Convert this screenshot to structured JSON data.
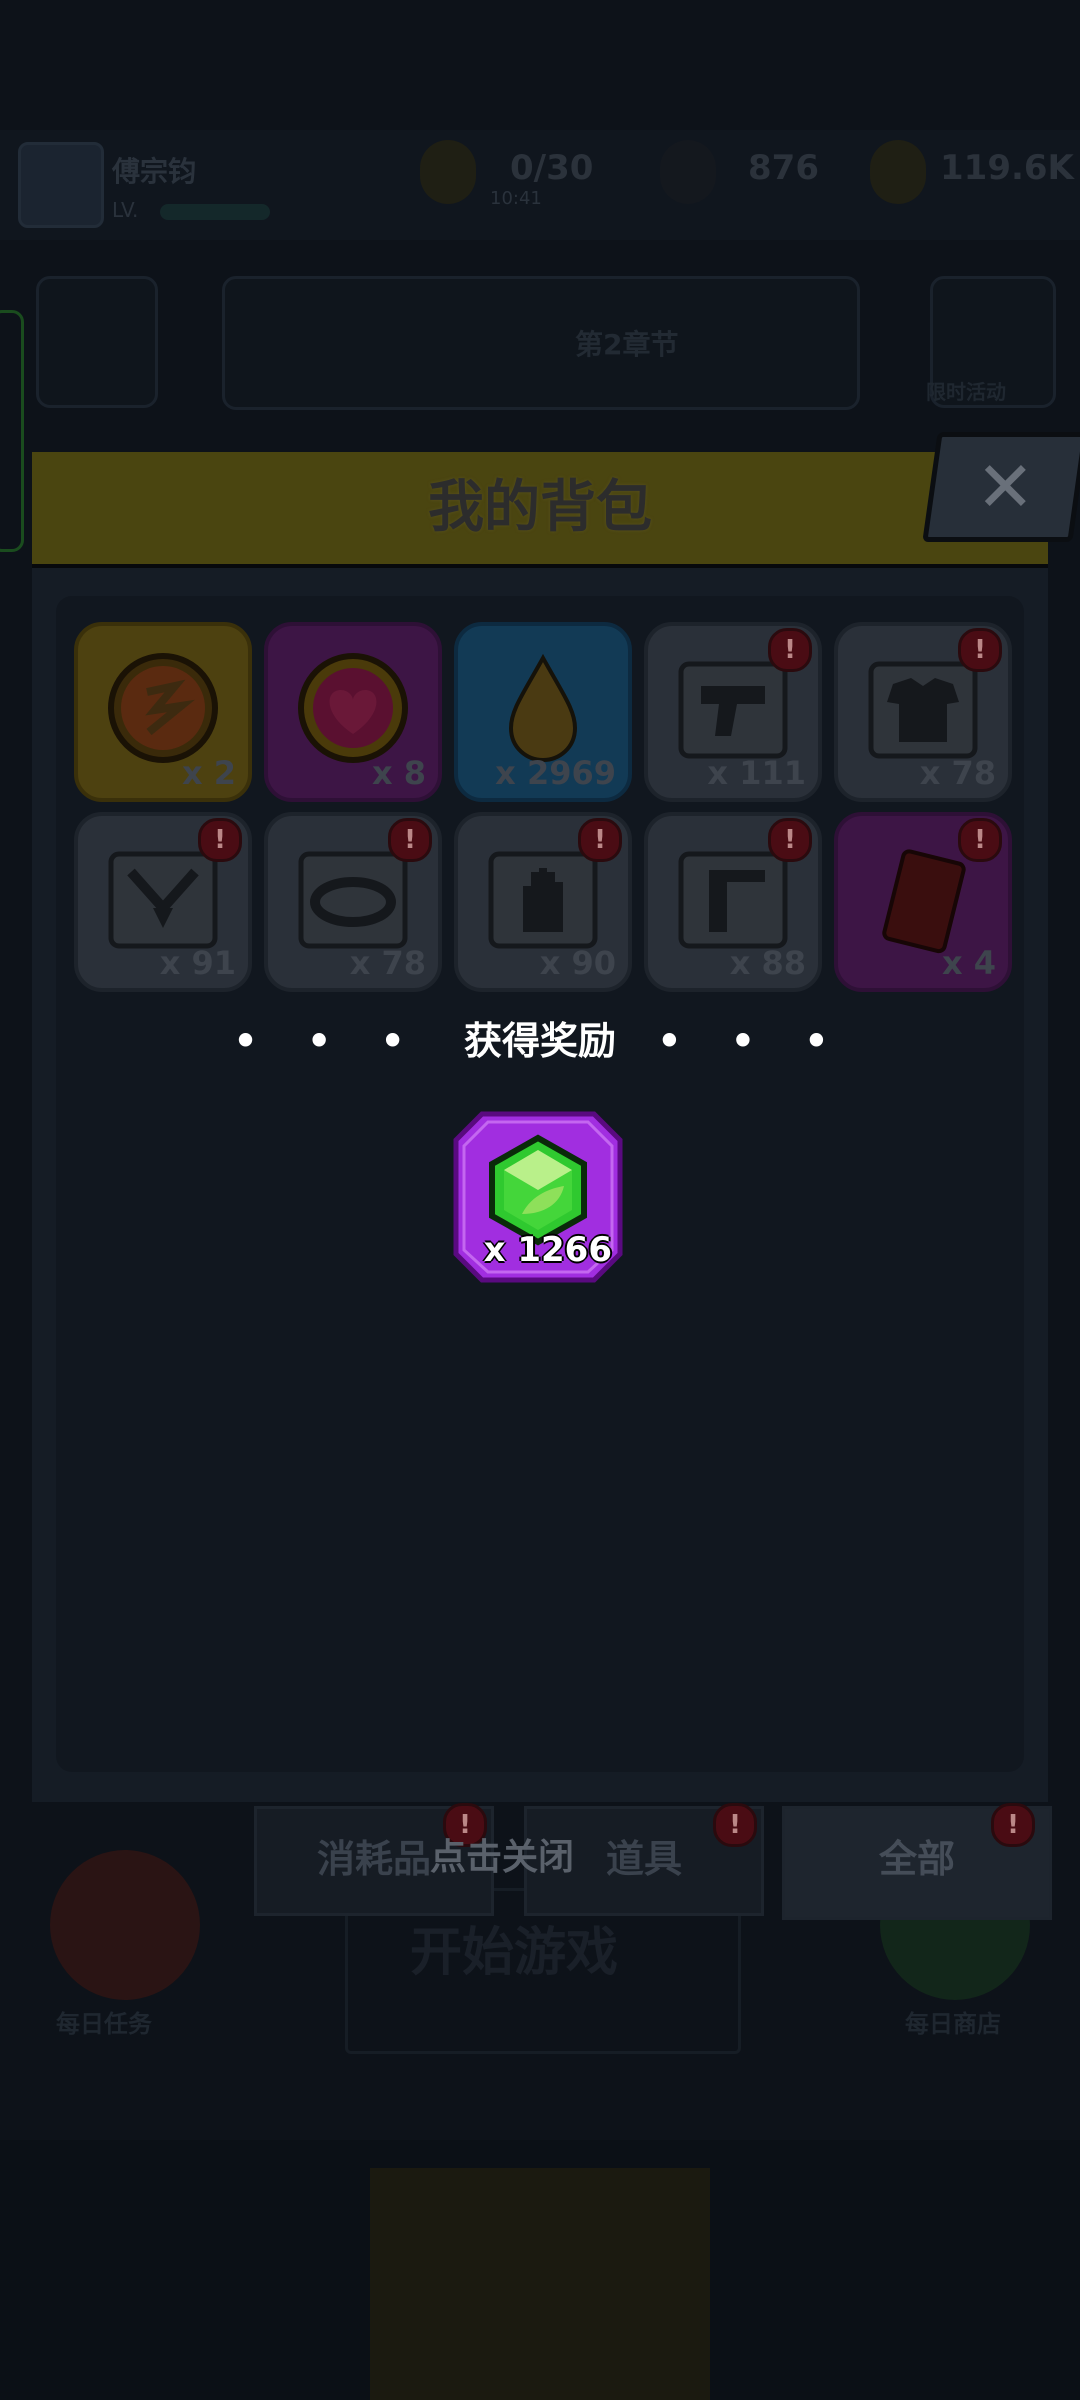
{
  "background": {
    "player_name": "傅宗钧",
    "level": "LV.",
    "resources": [
      {
        "icon": "energy-icon",
        "value": "0/30"
      },
      {
        "icon": "gem-icon",
        "value": "876"
      },
      {
        "icon": "coin-icon",
        "value": "119.6K"
      }
    ],
    "energy_timer": "10:41",
    "mid_label": "第2章节",
    "start_button": "开始游戏",
    "daily_left": "每日任务",
    "daily_right": "每日商店",
    "side_label": "限时活动"
  },
  "backpack": {
    "title": "我的背包",
    "close_icon": "close-icon",
    "items": [
      {
        "icon": "rune-orb-icon",
        "rarity": "gold",
        "qty": "x 2",
        "alert": false
      },
      {
        "icon": "heart-orb-icon",
        "rarity": "purple",
        "qty": "x 8",
        "alert": false
      },
      {
        "icon": "oil-drop-icon",
        "rarity": "blue",
        "qty": "x 2969",
        "alert": false
      },
      {
        "icon": "weapon-blueprint-icon",
        "rarity": "grey",
        "qty": "x 111",
        "alert": true
      },
      {
        "icon": "armor-blueprint-icon",
        "rarity": "grey",
        "qty": "x 78",
        "alert": true
      },
      {
        "icon": "necklace-blueprint-icon",
        "rarity": "grey",
        "qty": "x 91",
        "alert": true
      },
      {
        "icon": "ring-blueprint-icon",
        "rarity": "grey",
        "qty": "x 78",
        "alert": true
      },
      {
        "icon": "glove-blueprint-icon",
        "rarity": "grey",
        "qty": "x 90",
        "alert": true
      },
      {
        "icon": "boot-blueprint-icon",
        "rarity": "grey",
        "qty": "x 88",
        "alert": true
      },
      {
        "icon": "red-card-icon",
        "rarity": "purple",
        "qty": "x 4",
        "alert": true
      }
    ],
    "tabs": [
      {
        "label": "消耗品",
        "alert": true
      },
      {
        "label": "道具",
        "alert": true
      },
      {
        "label": "全部",
        "alert": true
      }
    ]
  },
  "reward": {
    "title": "获得奖励",
    "dots": "• • •",
    "item_icon": "emerald-gem-icon",
    "qty": "x 1266",
    "close_hint": "点击关闭"
  },
  "colors": {
    "overlay": "#0d1219",
    "reward_purple": "#a12ee0",
    "emerald": "#2fc92f"
  }
}
